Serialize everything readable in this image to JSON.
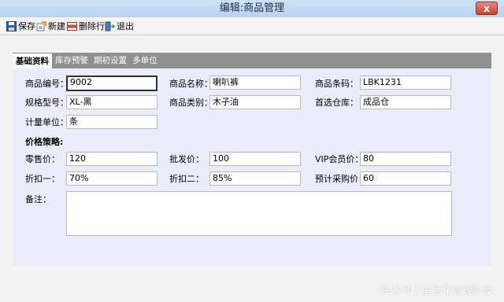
{
  "window": {
    "title": "编辑:商品管理",
    "close": "x"
  },
  "toolbar": {
    "save": "保存",
    "new": "新建",
    "delete_row": "删除行",
    "exit": "退出"
  },
  "tabs": [
    "基础资料",
    "库存预警",
    "期初设置",
    "多单位"
  ],
  "form": {
    "code_label": "商品编号：",
    "code_value": "9002",
    "name_label": "商品名称：",
    "name_value": "喇叭裤",
    "barcode_label": "商品条码：",
    "barcode_value": "LBK1231",
    "spec_label": "规格型号：",
    "spec_value": "XL-黑",
    "category_label": "商品类别：",
    "category_value": "木子油",
    "warehouse_label": "首选仓库：",
    "warehouse_value": "成品仓",
    "unit_label": "计量单位：",
    "unit_value": "条",
    "price_strategy_label": "价格策略:",
    "retail_label": "零售价：",
    "retail_value": "120",
    "wholesale_label": "批发价：",
    "wholesale_value": "100",
    "vip_label": "VIP会员价：",
    "vip_value": "80",
    "discount1_label": "折扣一：",
    "discount1_value": "70%",
    "discount2_label": "折扣二：",
    "discount2_value": "85%",
    "purchase_label": "预计采购价：",
    "purchase_value": "60",
    "remark_label": "备注：",
    "remark_value": ""
  },
  "watermark": "头条号 / 信息化管理杂谈"
}
